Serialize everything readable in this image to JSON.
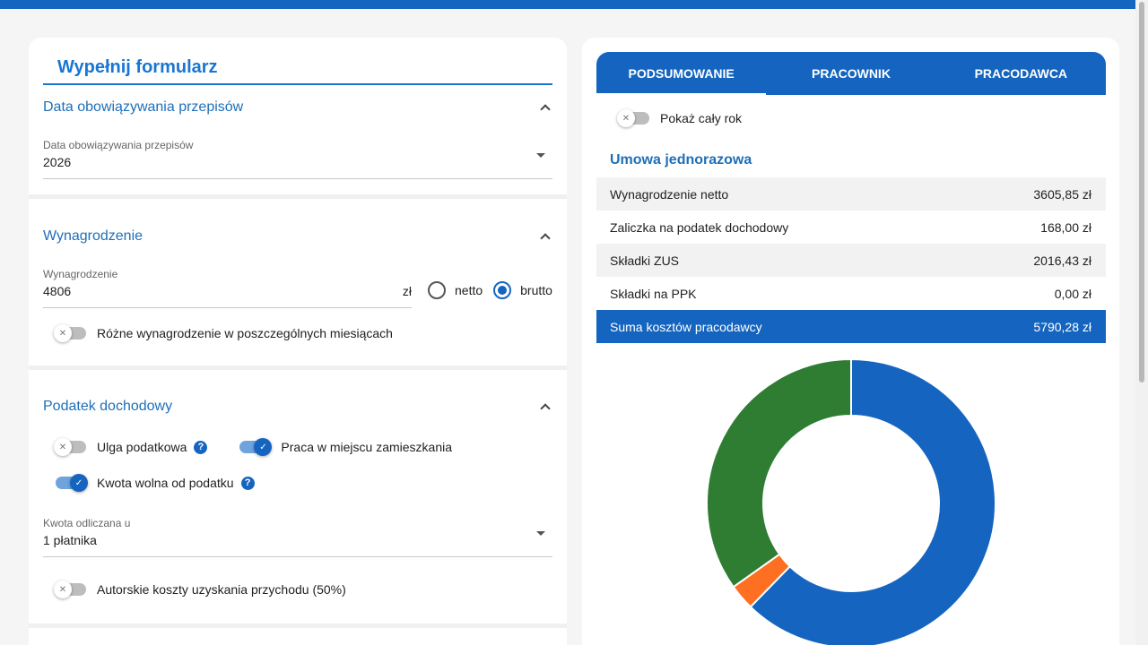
{
  "form": {
    "title": "Wypełnij formularz",
    "sections": {
      "date": {
        "title": "Data obowiązywania przepisów",
        "field_label": "Data obowiązywania przepisów",
        "field_value": "2026"
      },
      "salary": {
        "title": "Wynagrodzenie",
        "field_label": "Wynagrodzenie",
        "field_value": "4806",
        "currency": "zł",
        "radio_netto": "netto",
        "radio_brutto": "brutto",
        "selected": "brutto",
        "toggle_label": "Różne wynagrodzenie w poszczególnych miesiącach"
      },
      "tax": {
        "title": "Podatek dochodowy",
        "ulga_label": "Ulga podatkowa",
        "praca_label": "Praca w miejscu zamieszkania",
        "kwota_label": "Kwota wolna od podatku",
        "odliczana_label": "Kwota odliczana u",
        "odliczana_value": "1 płatnika",
        "autorskie_label": "Autorskie koszty uzyskania przychodu (50%)"
      }
    }
  },
  "results": {
    "tabs": [
      "PODSUMOWANIE",
      "PRACOWNIK",
      "PRACODAWCA"
    ],
    "active_tab": "PODSUMOWANIE",
    "year_toggle_label": "Pokaż cały rok",
    "section_title": "Umowa jednorazowa",
    "rows": [
      {
        "label": "Wynagrodzenie netto",
        "value": "3605,85 zł"
      },
      {
        "label": "Zaliczka na podatek dochodowy",
        "value": "168,00 zł"
      },
      {
        "label": "Składki ZUS",
        "value": "2016,43 zł"
      },
      {
        "label": "Składki na PPK",
        "value": "0,00 zł"
      },
      {
        "label": "Suma kosztów pracodawcy",
        "value": "5790,28 zł"
      }
    ]
  },
  "colors": {
    "primary": "#1565c0",
    "green": "#2e7d32",
    "orange": "#ff6f22"
  },
  "chart_data": {
    "type": "pie",
    "donut": true,
    "categories": [
      "Wynagrodzenie netto",
      "Zaliczka na podatek dochodowy",
      "Składki ZUS",
      "Składki na PPK"
    ],
    "values": [
      3605.85,
      168.0,
      2016.43,
      0.0
    ],
    "colors": [
      "#1565c0",
      "#ff6f22",
      "#2e7d32",
      "#9e9e9e"
    ]
  }
}
